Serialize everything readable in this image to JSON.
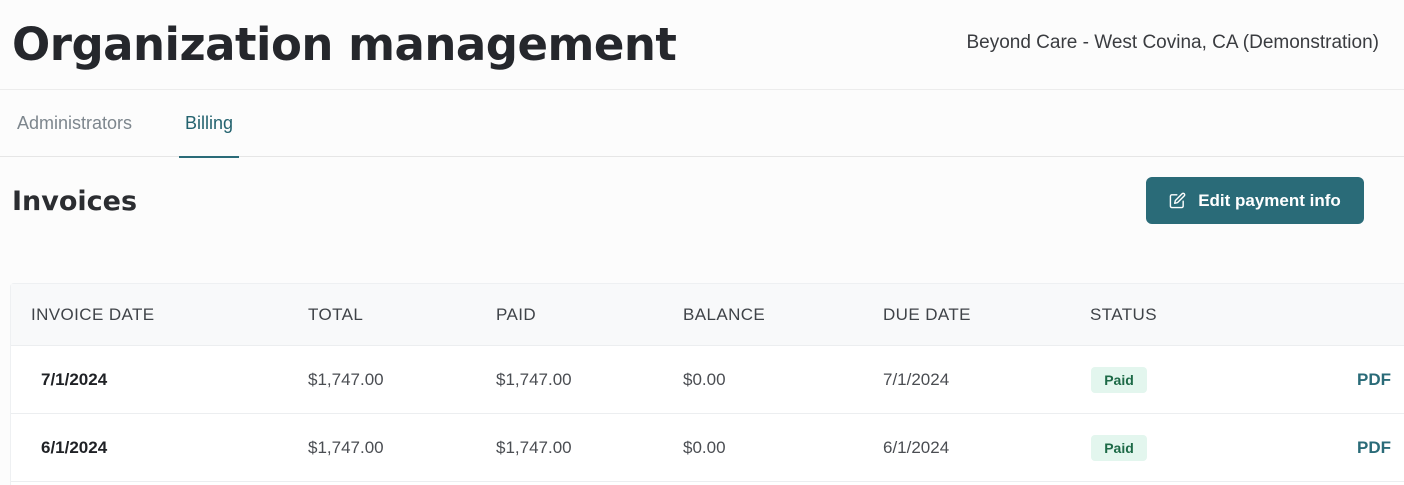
{
  "header": {
    "title": "Organization management",
    "org_name": "Beyond Care - West Covina, CA (Demonstration)"
  },
  "tabs": [
    {
      "label": "Administrators",
      "active": false
    },
    {
      "label": "Billing",
      "active": true
    }
  ],
  "invoices": {
    "title": "Invoices",
    "edit_button": {
      "label": "Edit payment info",
      "icon": "edit-icon"
    },
    "columns": [
      "INVOICE DATE",
      "TOTAL",
      "PAID",
      "BALANCE",
      "DUE DATE",
      "STATUS"
    ],
    "rows": [
      {
        "invoice_date": "7/1/2024",
        "total": "$1,747.00",
        "paid": "$1,747.00",
        "balance": "$0.00",
        "due_date": "7/1/2024",
        "status": "Paid",
        "link": "PDF"
      },
      {
        "invoice_date": "6/1/2024",
        "total": "$1,747.00",
        "paid": "$1,747.00",
        "balance": "$0.00",
        "due_date": "6/1/2024",
        "status": "Paid",
        "link": "PDF"
      }
    ]
  },
  "colors": {
    "accent": "#2a6b78",
    "paid_badge_bg": "#e3f6ee",
    "paid_badge_text": "#1d6a47"
  }
}
